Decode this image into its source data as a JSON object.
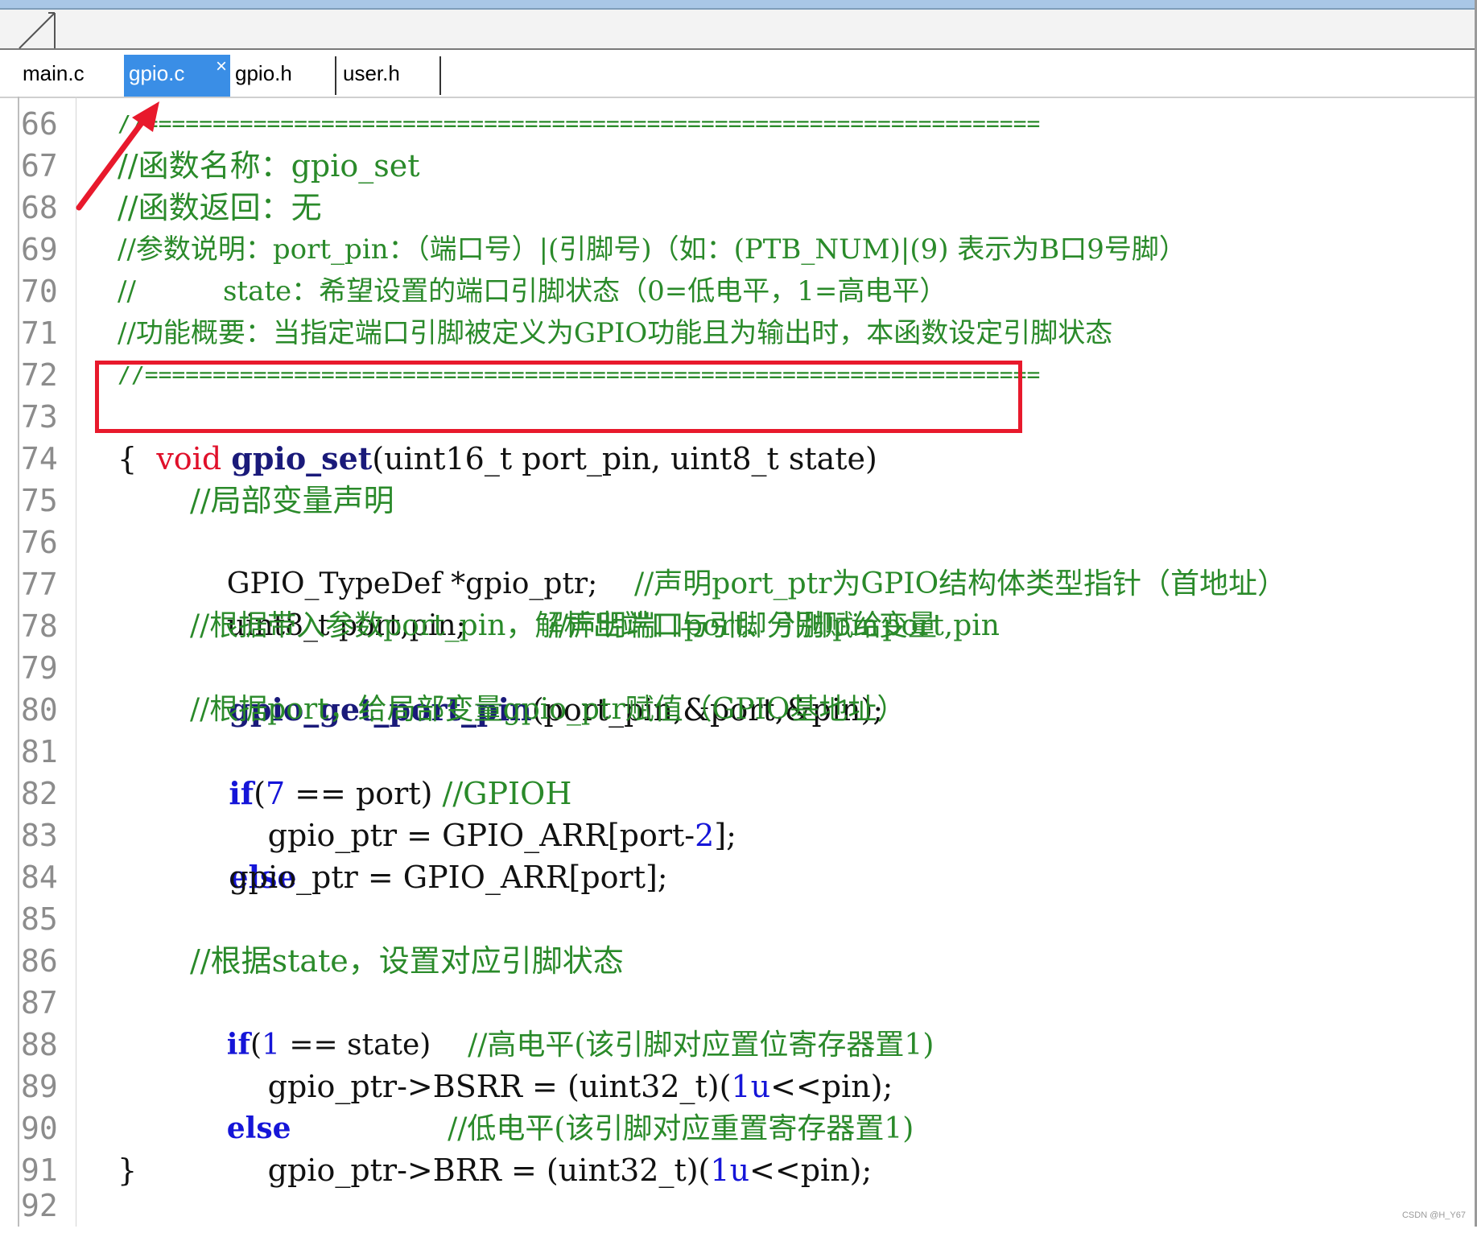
{
  "tabs": [
    {
      "label": "main.c",
      "active": false
    },
    {
      "label": "gpio.c",
      "active": true,
      "close": "×"
    },
    {
      "label": "gpio.h",
      "active": false
    },
    {
      "label": "user.h",
      "active": false
    }
  ],
  "lines": [
    {
      "num": "66",
      "text": "//=================================================================="
    },
    {
      "num": "67",
      "text": "//函数名称：gpio_set"
    },
    {
      "num": "68",
      "text": "//函数返回：无"
    },
    {
      "num": "69",
      "text": "//参数说明：port_pin：（端口号）|(引脚号)（如：(PTB_NUM)|(9) 表示为B口9号脚）"
    },
    {
      "num": "70",
      "text": "//          state：希望设置的端口引脚状态（0=低电平，1=高电平）"
    },
    {
      "num": "71",
      "text": "//功能概要：当指定端口引脚被定义为GPIO功能且为输出时，本函数设定引脚状态"
    },
    {
      "num": "72",
      "text": "//=================================================================="
    },
    {
      "num": "73",
      "kw": "void",
      "fn": "gpio_set",
      "rest": "(uint16_t port_pin, uint8_t state)"
    },
    {
      "num": "74",
      "text": "{"
    },
    {
      "num": "75",
      "comment": "//局部变量声明"
    },
    {
      "num": "76",
      "code": "GPIO_TypeDef *gpio_ptr;    ",
      "comment": "//声明port_ptr为GPIO结构体类型指针（首地址）"
    },
    {
      "num": "77",
      "code": "uint8_t port,pin;         ",
      "comment": "//声明端口port、引脚pin变量"
    },
    {
      "num": "78",
      "comment": "//根据带入参数port_pin，解析出端口与引脚分别赋给port,pin"
    },
    {
      "num": "79",
      "fn": "gpio_get_port_pin",
      "rest": "(port_pin,&port,&pin);"
    },
    {
      "num": "80",
      "comment": "//根据port，给局部变量gpio_ptr赋值（GPIO基地址）"
    },
    {
      "num": "81",
      "kw": "if",
      "pre": "(",
      "num_lit": "7",
      "rest": " == port) ",
      "comment": "//GPIOH"
    },
    {
      "num": "82",
      "code": "    gpio_ptr = GPIO_ARR[port-",
      "num_lit": "2",
      "rest": "];"
    },
    {
      "num": "83",
      "kw": "else"
    },
    {
      "num": "84",
      "code": "    gpio_ptr = GPIO_ARR[port];"
    },
    {
      "num": "85",
      "text": ""
    },
    {
      "num": "86",
      "comment": "//根据state，设置对应引脚状态"
    },
    {
      "num": "87",
      "kw": "if",
      "pre": "(",
      "num_lit": "1",
      "rest": " == state)    ",
      "comment": "//高电平(该引脚对应置位寄存器置1)"
    },
    {
      "num": "88",
      "code": "    gpio_ptr->BSRR = (uint32_t)(",
      "num_lit": "1u",
      "rest": "<<pin);"
    },
    {
      "num": "89",
      "kw": "else",
      "rest": "                 ",
      "comment": "//低电平(该引脚对应重置寄存器置1)"
    },
    {
      "num": "90",
      "code": "    gpio_ptr->BRR = (uint32_t)(",
      "num_lit": "1u",
      "rest": "<<pin);"
    },
    {
      "num": "91",
      "text": "}"
    },
    {
      "num": "92",
      "text": ""
    }
  ],
  "watermark": "CSDN @H_Y67"
}
